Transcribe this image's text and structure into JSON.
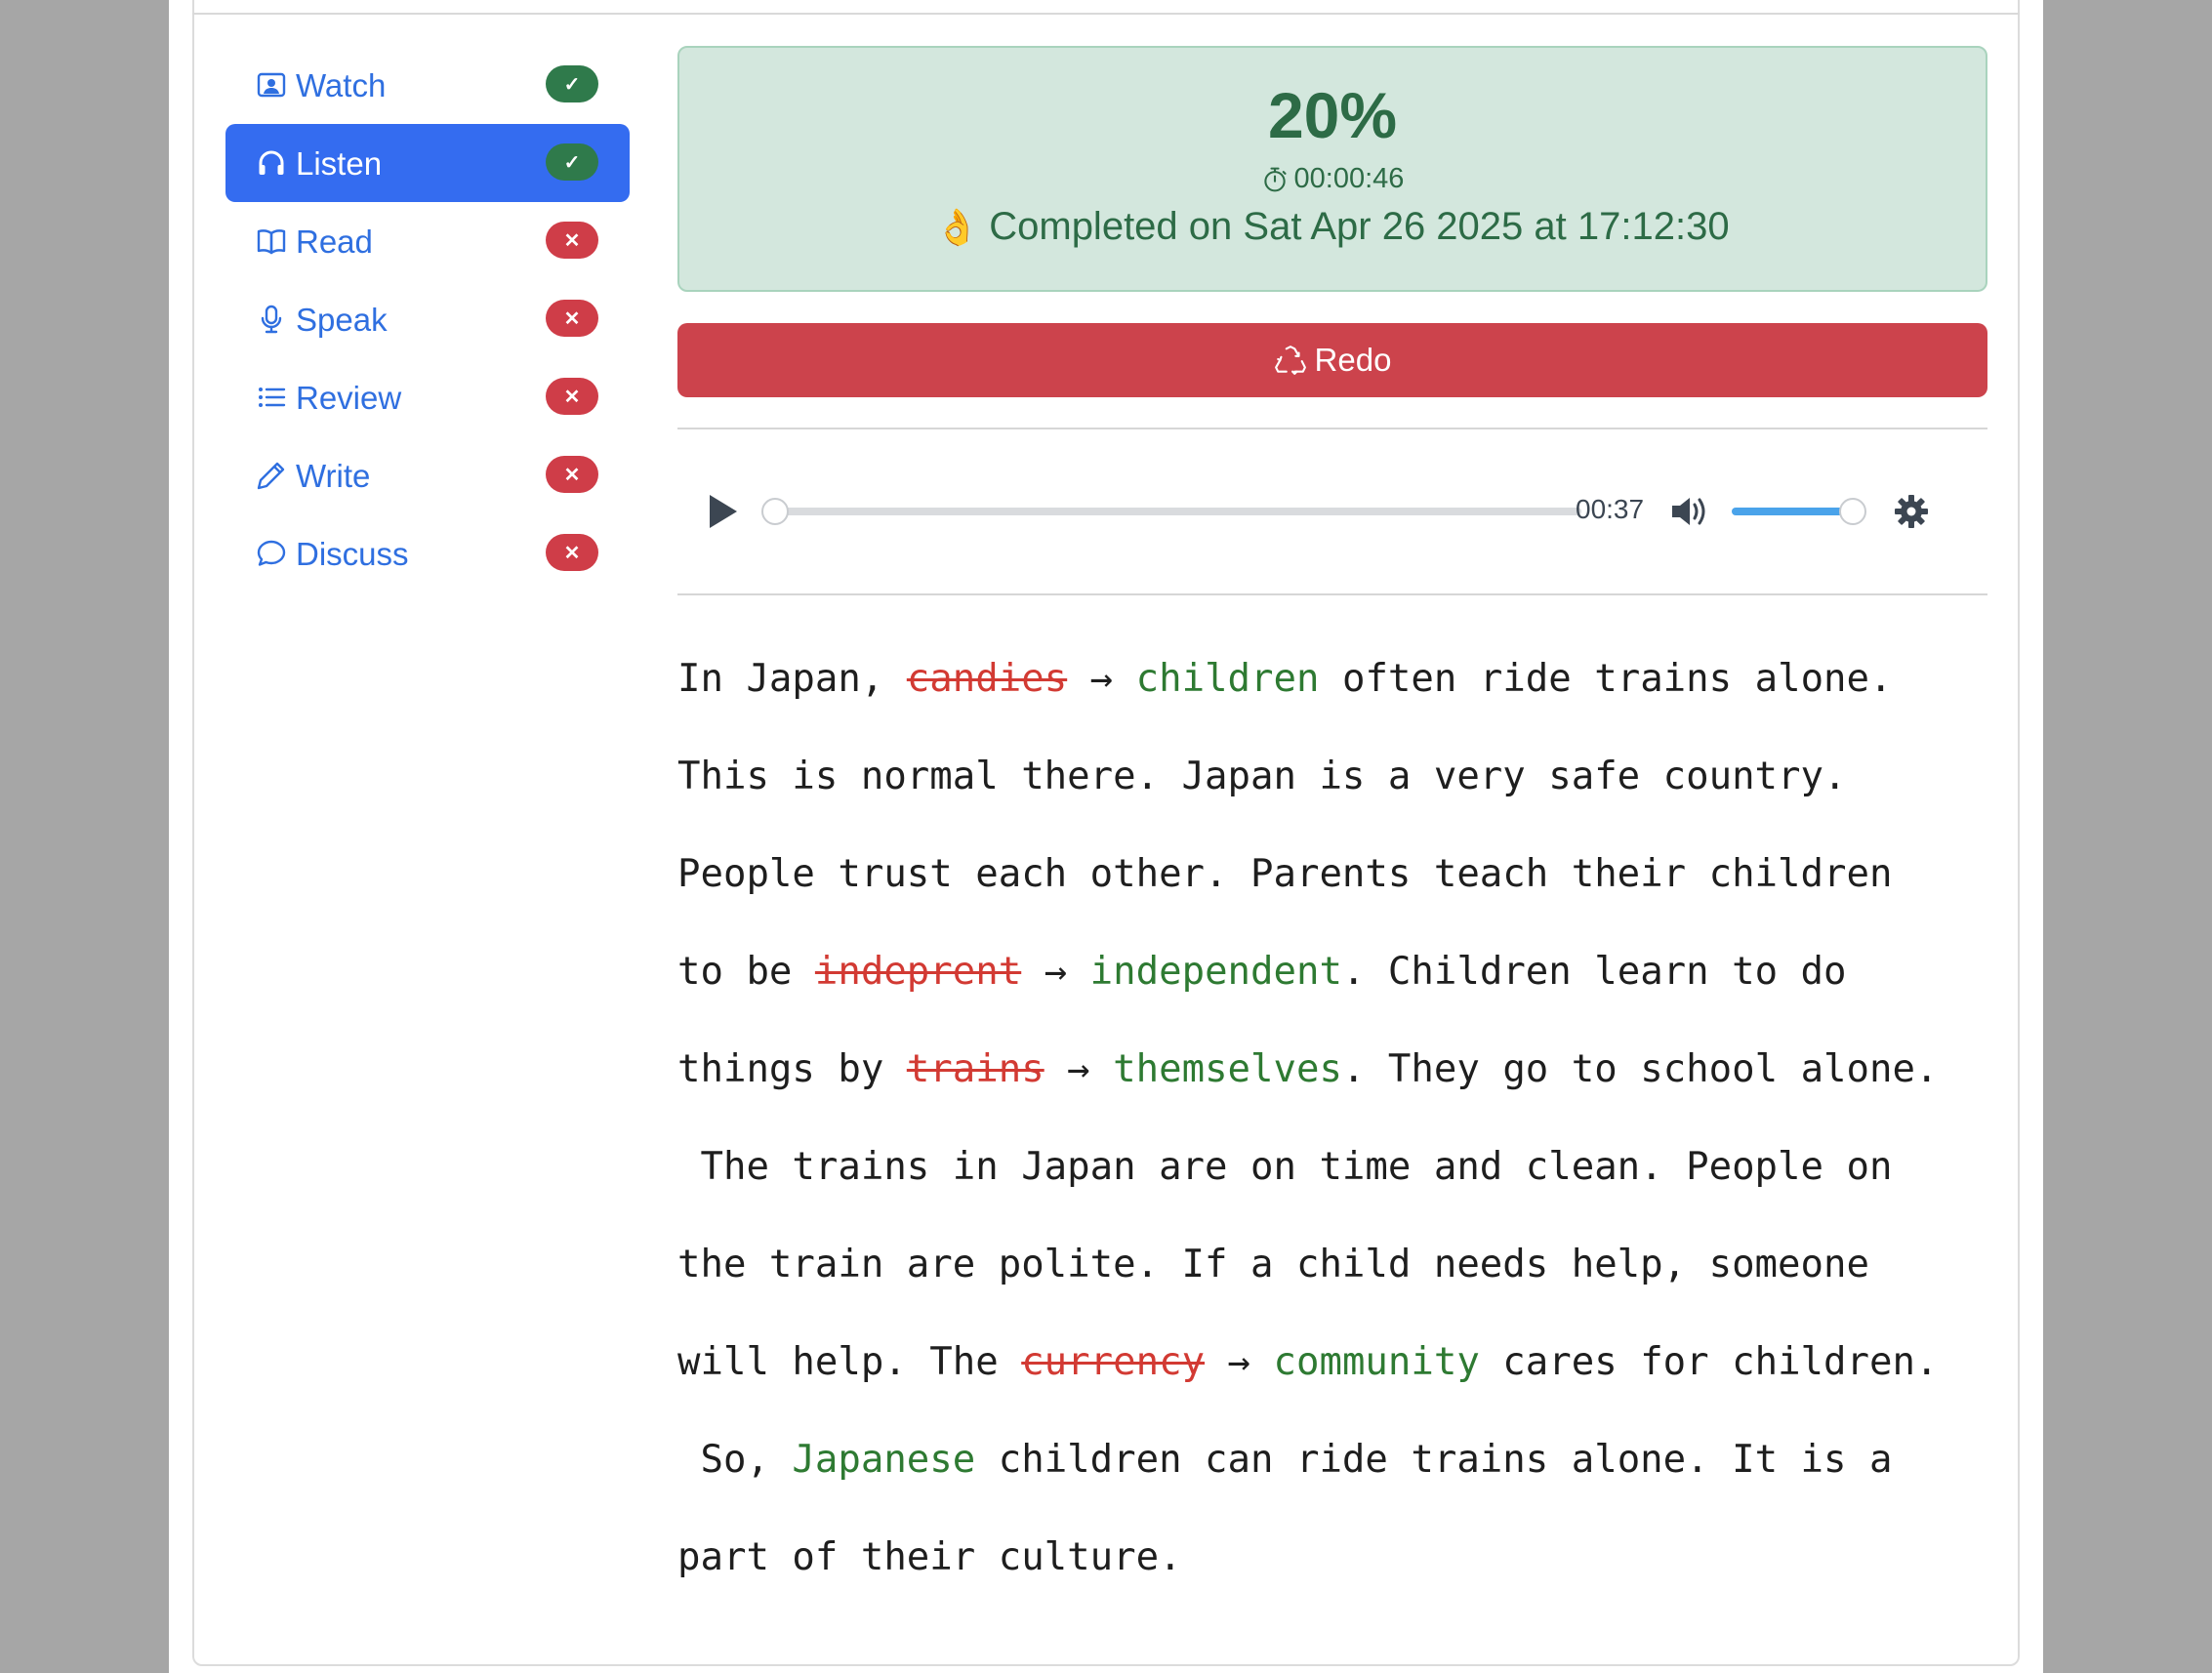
{
  "sidebar": {
    "items": [
      {
        "label": "Watch",
        "icon": "person-video-icon",
        "status": "✓",
        "state": "done"
      },
      {
        "label": "Listen",
        "icon": "headphones-icon",
        "status": "✓",
        "state": "done",
        "active": true
      },
      {
        "label": "Read",
        "icon": "book-icon",
        "status": "✕",
        "state": "todo"
      },
      {
        "label": "Speak",
        "icon": "mic-icon",
        "status": "✕",
        "state": "todo"
      },
      {
        "label": "Review",
        "icon": "list-icon",
        "status": "✕",
        "state": "todo"
      },
      {
        "label": "Write",
        "icon": "pencil-icon",
        "status": "✕",
        "state": "todo"
      },
      {
        "label": "Discuss",
        "icon": "chat-icon",
        "status": "✕",
        "state": "todo"
      }
    ]
  },
  "result": {
    "score": "20%",
    "elapsed": "00:00:46",
    "completed_emoji": "👌",
    "completed_text": "Completed on Sat Apr 26 2025 at 17:12:30"
  },
  "redo_label": "Redo",
  "player": {
    "time": "00:37",
    "progress": 0,
    "volume": 1.0
  },
  "text": {
    "lines": [
      [
        {
          "t": "In Japan, "
        },
        {
          "t": "candies",
          "c": "wrong"
        },
        {
          "t": " → ",
          "c": "arrow"
        },
        {
          "t": "children",
          "c": "right"
        },
        {
          "t": " often ride trains alone."
        }
      ],
      [
        {
          "t": "This is normal there. Japan is a very safe country."
        }
      ],
      [
        {
          "t": "People trust each other. Parents teach their children"
        }
      ],
      [
        {
          "t": "to be "
        },
        {
          "t": "indeprent",
          "c": "wrong"
        },
        {
          "t": " → ",
          "c": "arrow"
        },
        {
          "t": "independent",
          "c": "right"
        },
        {
          "t": ". Children learn to do"
        }
      ],
      [
        {
          "t": "things by "
        },
        {
          "t": "trains",
          "c": "wrong"
        },
        {
          "t": " → ",
          "c": "arrow"
        },
        {
          "t": "themselves",
          "c": "right"
        },
        {
          "t": ". They go to school alone."
        }
      ],
      [
        {
          "t": " The trains in Japan are on time and clean. People on"
        }
      ],
      [
        {
          "t": "the train are polite. If a child needs help, someone"
        }
      ],
      [
        {
          "t": "will help. The "
        },
        {
          "t": "currency",
          "c": "wrong"
        },
        {
          "t": " → ",
          "c": "arrow"
        },
        {
          "t": "community",
          "c": "right"
        },
        {
          "t": " cares for children."
        }
      ],
      [
        {
          "t": " So, "
        },
        {
          "t": "Japanese",
          "c": "right"
        },
        {
          "t": " children can ride trains alone. It is a"
        }
      ],
      [
        {
          "t": "part of their culture."
        }
      ]
    ]
  },
  "colors": {
    "accent": "#346cf0",
    "success": "#2f7a4b",
    "danger": "#cf3d48",
    "alert_bg": "#d3e7dd",
    "wrong": "#d23a33",
    "right": "#2e7a32"
  }
}
